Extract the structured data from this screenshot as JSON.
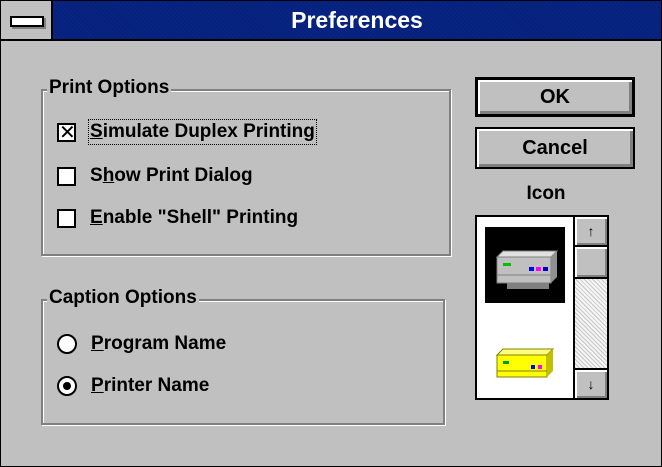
{
  "window": {
    "title": "Preferences"
  },
  "print_options": {
    "legend": "Print Options",
    "items": [
      {
        "mnemonic": "S",
        "rest": "imulate Duplex Printing",
        "checked": true
      },
      {
        "pre": "S",
        "mnemonic": "h",
        "rest": "ow Print Dialog",
        "checked": false
      },
      {
        "mnemonic": "E",
        "rest": "nable \"Shell\" Printing",
        "checked": false
      }
    ]
  },
  "caption_options": {
    "legend": "Caption Options",
    "items": [
      {
        "mnemonic": "P",
        "rest": "rogram Name",
        "selected": false
      },
      {
        "mnemonic": "P",
        "rest": "rinter Name",
        "selected": true
      }
    ]
  },
  "buttons": {
    "ok": "OK",
    "cancel": "Cancel"
  },
  "icon_picker": {
    "label": "Icon",
    "items": [
      {
        "icon": "printer-gray-icon",
        "selected": true
      },
      {
        "icon": "printer-yellow-icon",
        "selected": false
      }
    ],
    "scroll_up_glyph": "↑",
    "scroll_down_glyph": "↓",
    "check_glyph": "✕"
  }
}
